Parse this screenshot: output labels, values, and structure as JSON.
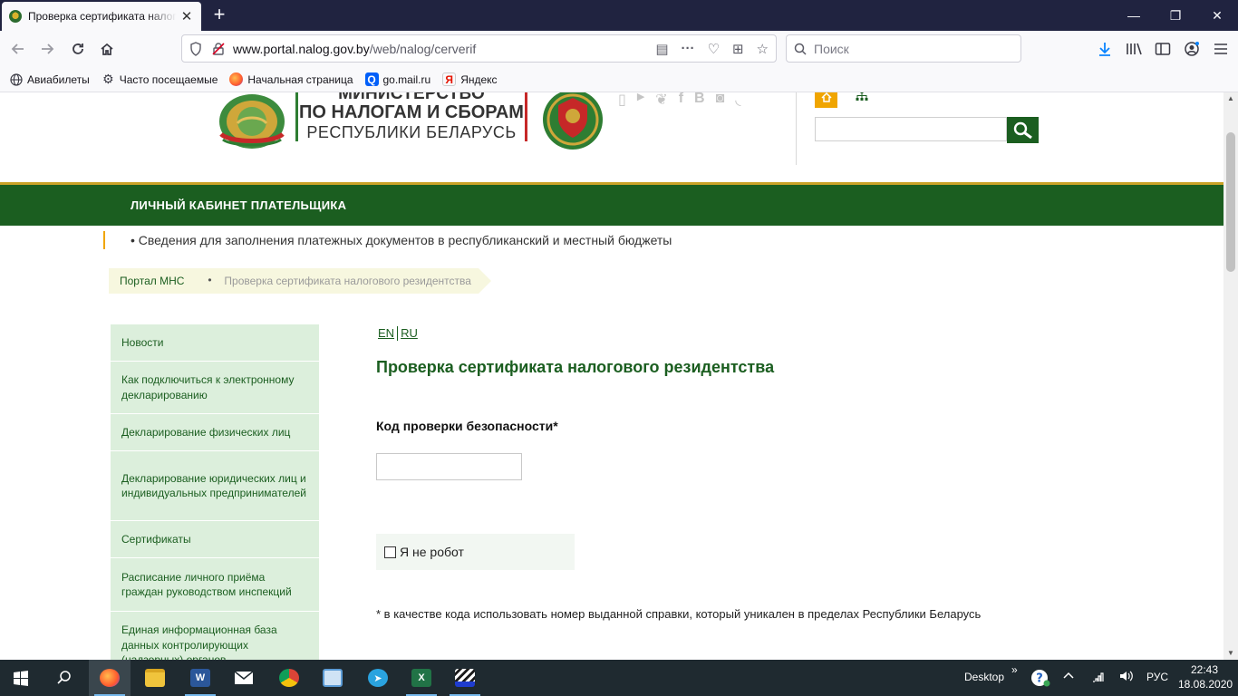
{
  "browser": {
    "tab_title": "Проверка сертификата налоговог",
    "url_domain": "www.portal.nalog.gov.by",
    "url_path": "/web/nalog/cerverif",
    "search_placeholder": "Поиск"
  },
  "bookmarks": [
    {
      "label": "Авиабилеты",
      "icon": "globe-icon"
    },
    {
      "label": "Часто посещаемые",
      "icon": "gear-icon"
    },
    {
      "label": "Начальная страница",
      "icon": "firefox-icon"
    },
    {
      "label": "go.mail.ru",
      "icon": "search-icon"
    },
    {
      "label": "Яндекс",
      "icon": "yandex-icon"
    }
  ],
  "header": {
    "ministry_line1": "МИНИСТЕРСТВО",
    "ministry_line2": "ПО НАЛОГАМ И СБОРАМ",
    "ministry_line3": "РЕСПУБЛИКИ БЕЛАРУСЬ",
    "social_icons": [
      "mobile-icon",
      "youtube-icon",
      "twitter-icon",
      "facebook-icon",
      "vk-icon",
      "instagram-icon",
      "rss-icon"
    ]
  },
  "greenbar": {
    "label": "ЛИЧНЫЙ КАБИНЕТ ПЛАТЕЛЬЩИКА"
  },
  "ticker": "• Сведения для заполнения платежных документов в республиканский и местный бюджеты",
  "breadcrumb": {
    "home": "Портал МНС",
    "separator": "•",
    "current": "Проверка сертификата налогового резидентства"
  },
  "sidebar": {
    "items": [
      {
        "label": "Новости"
      },
      {
        "label": "Как подключиться к электронному декларированию"
      },
      {
        "label": "Декларирование физических лиц"
      },
      {
        "label": "Декларирование юридических лиц и индивидуальных предпринимателей"
      },
      {
        "label": "Сертификаты"
      },
      {
        "label": "Расписание личного приёма граждан руководством инспекций"
      },
      {
        "label": "Единая информационная база данных контролирующих (надзорных) органов"
      }
    ]
  },
  "main": {
    "lang_en": "EN",
    "lang_ru": "RU",
    "title": "Проверка сертификата налогового резидентства",
    "code_label": "Код проверки безопасности*",
    "code_value": "",
    "captcha_label": "Я не робот",
    "footnote": "* в качестве кода использовать номер выданной справки, который уникален в пределах Республики Беларусь"
  },
  "taskbar": {
    "desktop_label": "Desktop",
    "chevron": "»",
    "lang": "РУС",
    "time": "22:43",
    "date": "18.08.2020"
  }
}
